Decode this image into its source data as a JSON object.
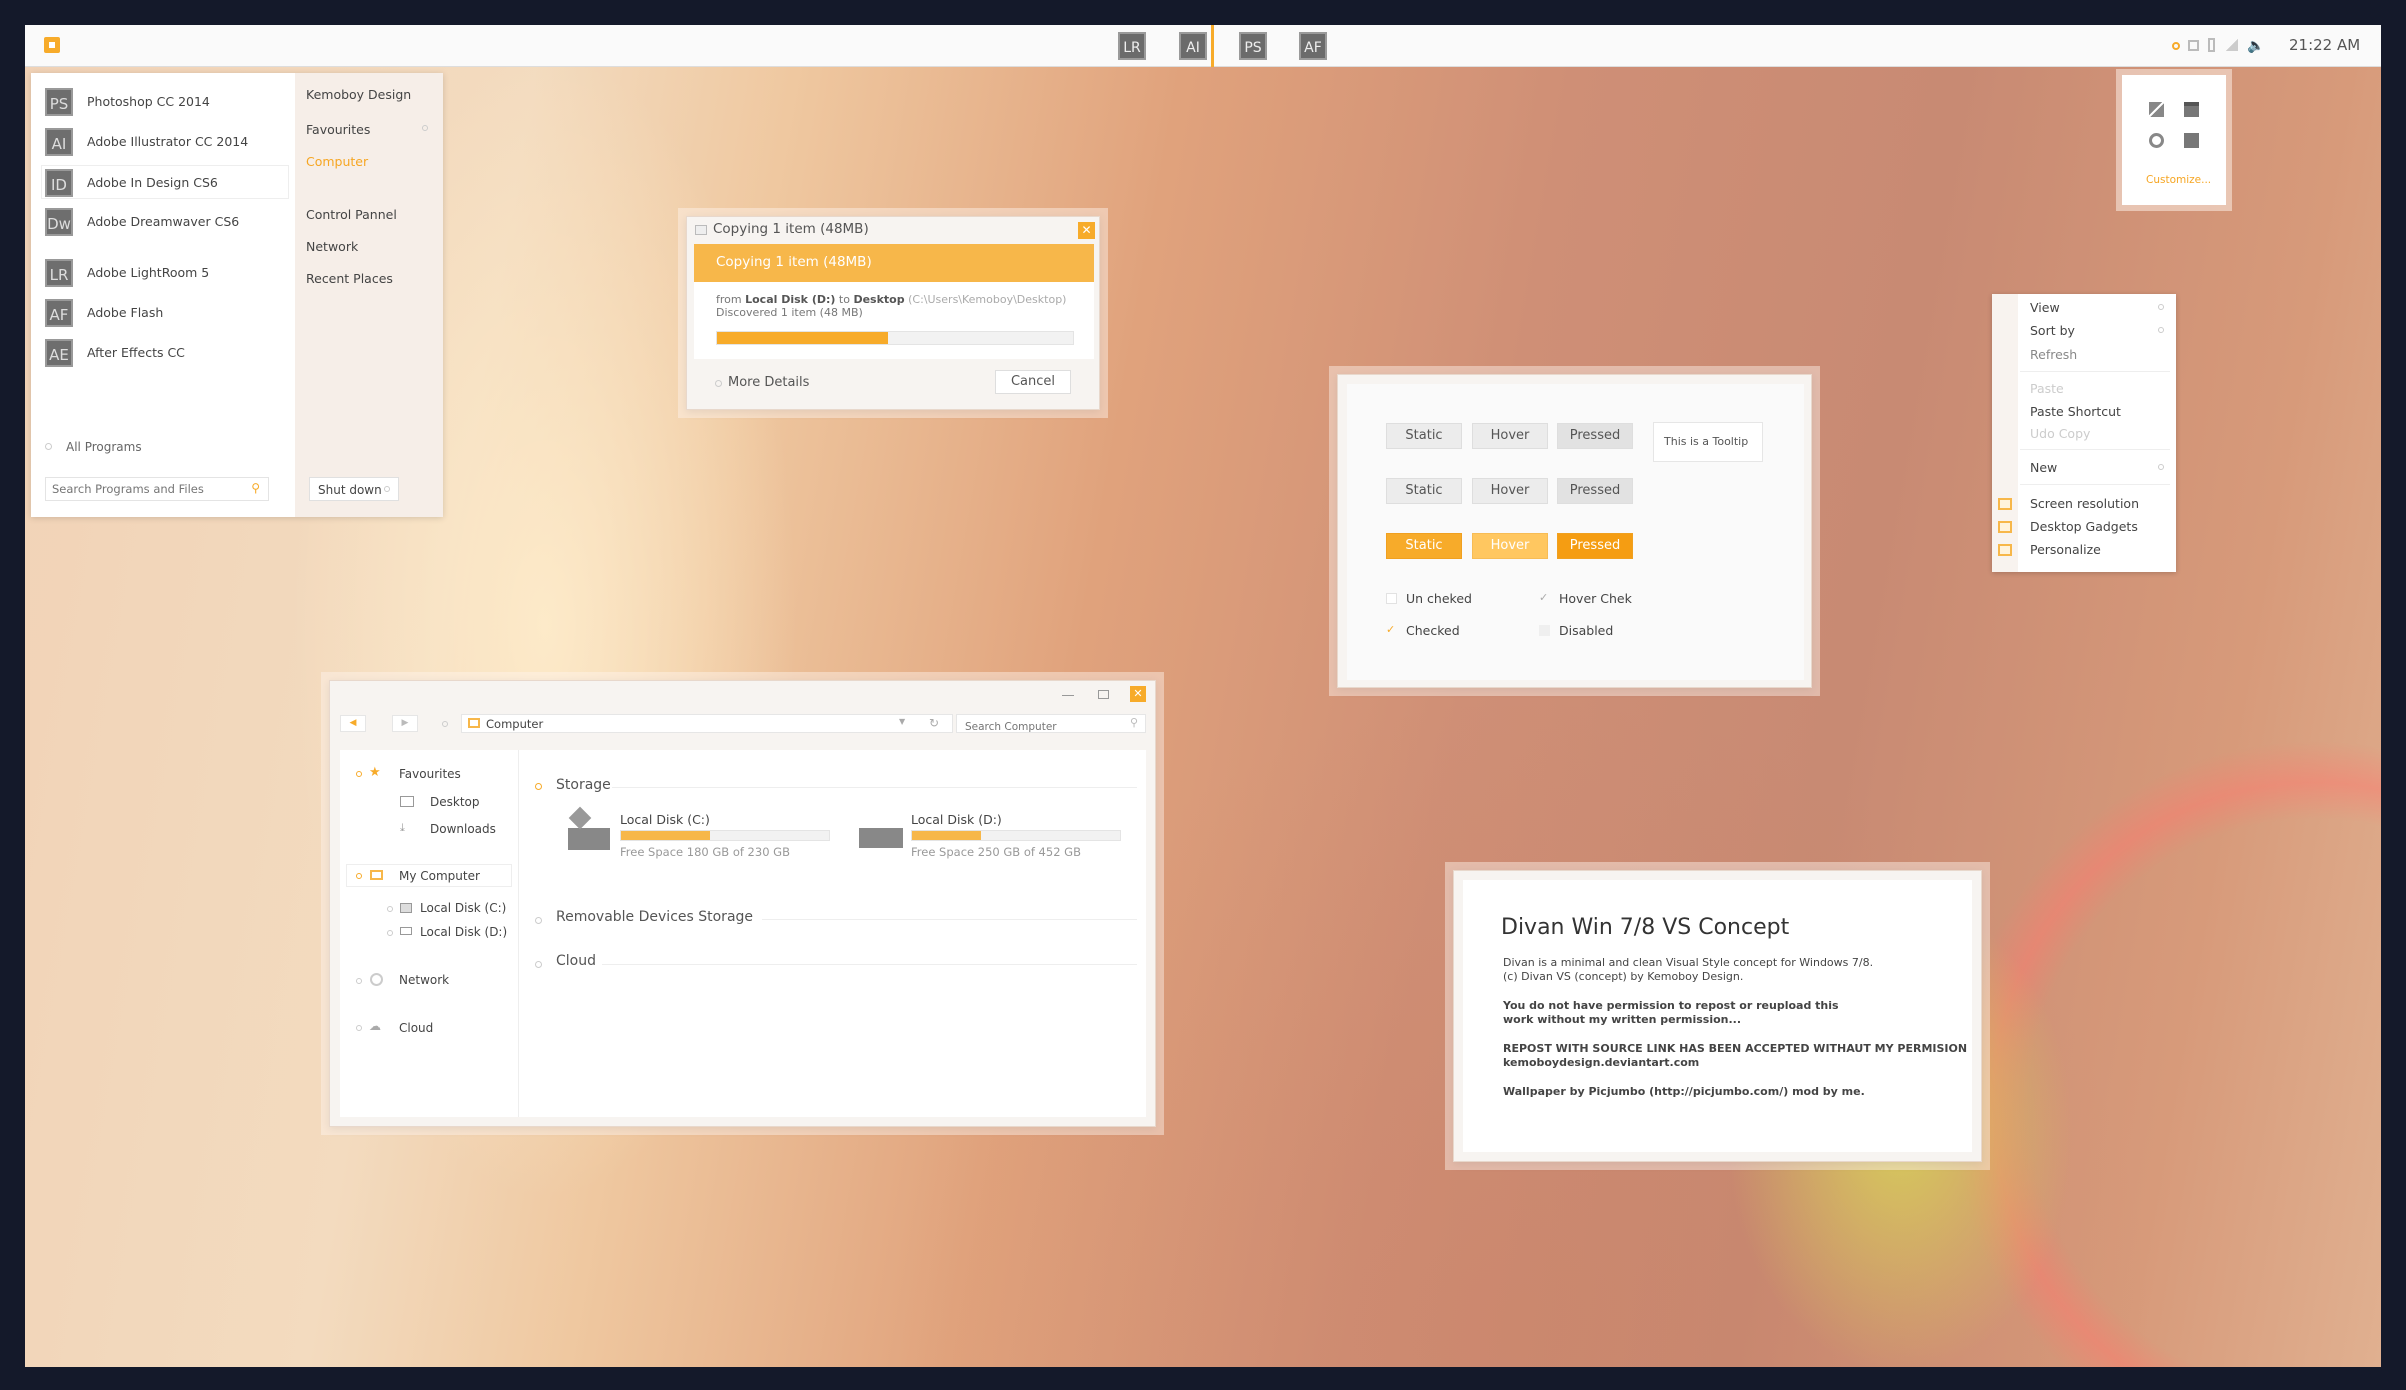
{
  "taskbar": {
    "pinned": [
      "LR",
      "AI",
      "PS",
      "AF"
    ],
    "time": "21:22 AM",
    "start_icon": "start-square-icon",
    "tray_icons": [
      "notification-dot-icon",
      "network-icon",
      "battery-icon",
      "signal-icon",
      "volume-icon"
    ]
  },
  "start_menu": {
    "apps": [
      {
        "abbr": "PS",
        "name": "Photoshop CC 2014"
      },
      {
        "abbr": "AI",
        "name": "Adobe Illustrator CC 2014"
      },
      {
        "abbr": "ID",
        "name": "Adobe In Design CS6"
      },
      {
        "abbr": "Dw",
        "name": "Adobe Dreamwaver CS6"
      },
      {
        "abbr": "LR",
        "name": "Adobe LightRoom 5"
      },
      {
        "abbr": "AF",
        "name": "Adobe Flash"
      },
      {
        "abbr": "AE",
        "name": "After Effects CC"
      }
    ],
    "all_programs": "All Programs",
    "search_placeholder": "Search Programs and Files",
    "right": {
      "user": "Kemoboy Design",
      "favourites": "Favourites",
      "computer": "Computer",
      "control_panel": "Control Pannel",
      "network": "Network",
      "recent": "Recent Places"
    },
    "shutdown": "Shut down"
  },
  "copy_dialog": {
    "title": "Copying 1 item (48MB)",
    "header": "Copying 1 item (48MB)",
    "from_label": "from",
    "from": "Local Disk (D:)",
    "to_label": "to",
    "to": "Desktop",
    "path": "(C:\\Users\\Kemoboy\\Desktop)",
    "discovered": "Discovered 1 item (48 MB)",
    "progress": 0.48,
    "more_details": "More Details",
    "cancel": "Cancel"
  },
  "widget": {
    "customize": "Customize..."
  },
  "context_menu": {
    "items": [
      "View",
      "Sort by",
      "Refresh",
      "Paste",
      "Paste Shortcut",
      "Udo Copy",
      "New",
      "Screen resolution",
      "Desktop Gadgets",
      "Personalize"
    ]
  },
  "controls": {
    "row1": [
      "Static",
      "Hover",
      "Pressed"
    ],
    "row2": [
      "Static",
      "Hover",
      "Pressed"
    ],
    "row3": [
      "Static",
      "Hover",
      "Pressed"
    ],
    "tooltip": "This is a Tooltip",
    "checks": [
      "Un cheked",
      "Hover Chek",
      "Checked",
      "Disabled"
    ]
  },
  "explorer": {
    "address": "Computer",
    "search_placeholder": "Search Computer",
    "nav": {
      "favourites": "Favourites",
      "desktop": "Desktop",
      "downloads": "Downloads",
      "my_computer": "My Computer",
      "disk_c": "Local Disk (C:)",
      "disk_d": "Local Disk (D:)",
      "network": "Network",
      "cloud": "Cloud"
    },
    "sections": [
      "Storage",
      "Removable Devices Storage",
      "Cloud"
    ],
    "drives": [
      {
        "name": "Local Disk (C:)",
        "free": "Free Space 180 GB of 230 GB",
        "used": 0.43
      },
      {
        "name": "Local Disk (D:)",
        "free": "Free Space 250 GB of 452 GB",
        "used": 0.33
      }
    ]
  },
  "about": {
    "title": "Divan Win 7/8 VS Concept",
    "line1": "Divan is a minimal and clean Visual Style concept for Windows 7/8.",
    "line2": "(c) Divan VS (concept) by Kemoboy Design.",
    "line3": "You do not have permission to repost or reupload this",
    "line4": "work without my written permission...",
    "line5": "REPOST WITH SOURCE LINK HAS BEEN ACCEPTED WITHAUT MY PERMISION",
    "line6": "kemoboydesign.deviantart.com",
    "line7": "Wallpaper by Picjumbo (http://picjumbo.com/) mod by me."
  },
  "colors": {
    "accent": "#f7ab2a",
    "accent_light": "#ffc760",
    "window_bg": "#f7f4f1",
    "frame": "#14192a"
  }
}
